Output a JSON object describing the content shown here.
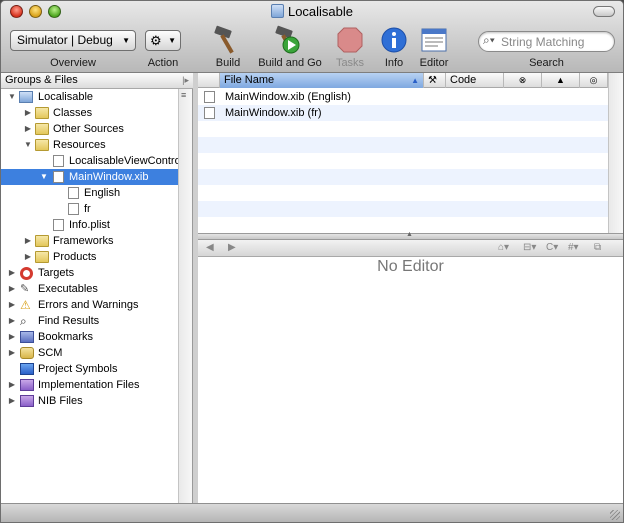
{
  "window": {
    "title": "Localisable"
  },
  "toolbar": {
    "scheme_popup": "Simulator | Debug",
    "overview_label": "Overview",
    "action_label": "Action",
    "build_label": "Build",
    "build_and_go_label": "Build and Go",
    "tasks_label": "Tasks",
    "info_label": "Info",
    "editor_label": "Editor",
    "search_label": "Search",
    "search_placeholder": "String Matching"
  },
  "sidebar": {
    "header": "Groups & Files",
    "items": [
      {
        "label": "Localisable",
        "icon": "project-icon",
        "expanded": true
      },
      {
        "label": "Classes",
        "icon": "folder-icon"
      },
      {
        "label": "Other Sources",
        "icon": "folder-icon"
      },
      {
        "label": "Resources",
        "icon": "folder-icon",
        "expanded": true
      },
      {
        "label": "LocalisableViewContro",
        "icon": "xib-file-icon"
      },
      {
        "label": "MainWindow.xib",
        "icon": "xib-file-icon",
        "selected": true,
        "expanded": true
      },
      {
        "label": "English",
        "icon": "xib-file-icon"
      },
      {
        "label": "fr",
        "icon": "xib-file-icon"
      },
      {
        "label": "Info.plist",
        "icon": "plist-file-icon"
      },
      {
        "label": "Frameworks",
        "icon": "folder-icon"
      },
      {
        "label": "Products",
        "icon": "folder-icon"
      },
      {
        "label": "Targets",
        "icon": "target-icon"
      },
      {
        "label": "Executables",
        "icon": "executable-icon"
      },
      {
        "label": "Errors and Warnings",
        "icon": "warning-icon"
      },
      {
        "label": "Find Results",
        "icon": "magnifier-icon"
      },
      {
        "label": "Bookmarks",
        "icon": "bookmark-icon"
      },
      {
        "label": "SCM",
        "icon": "scm-icon"
      },
      {
        "label": "Project Symbols",
        "icon": "symbols-icon"
      },
      {
        "label": "Implementation Files",
        "icon": "smart-group-icon"
      },
      {
        "label": "NIB Files",
        "icon": "smart-group-icon"
      }
    ]
  },
  "file_list": {
    "columns": {
      "file_name": "File Name",
      "code": "Code"
    },
    "rows": [
      {
        "name": "MainWindow.xib (English)"
      },
      {
        "name": "MainWindow.xib (fr)"
      }
    ]
  },
  "editor": {
    "placeholder": "No Editor"
  },
  "colors": {
    "selection": "#3d80df",
    "alt_row": "#edf3fe"
  }
}
